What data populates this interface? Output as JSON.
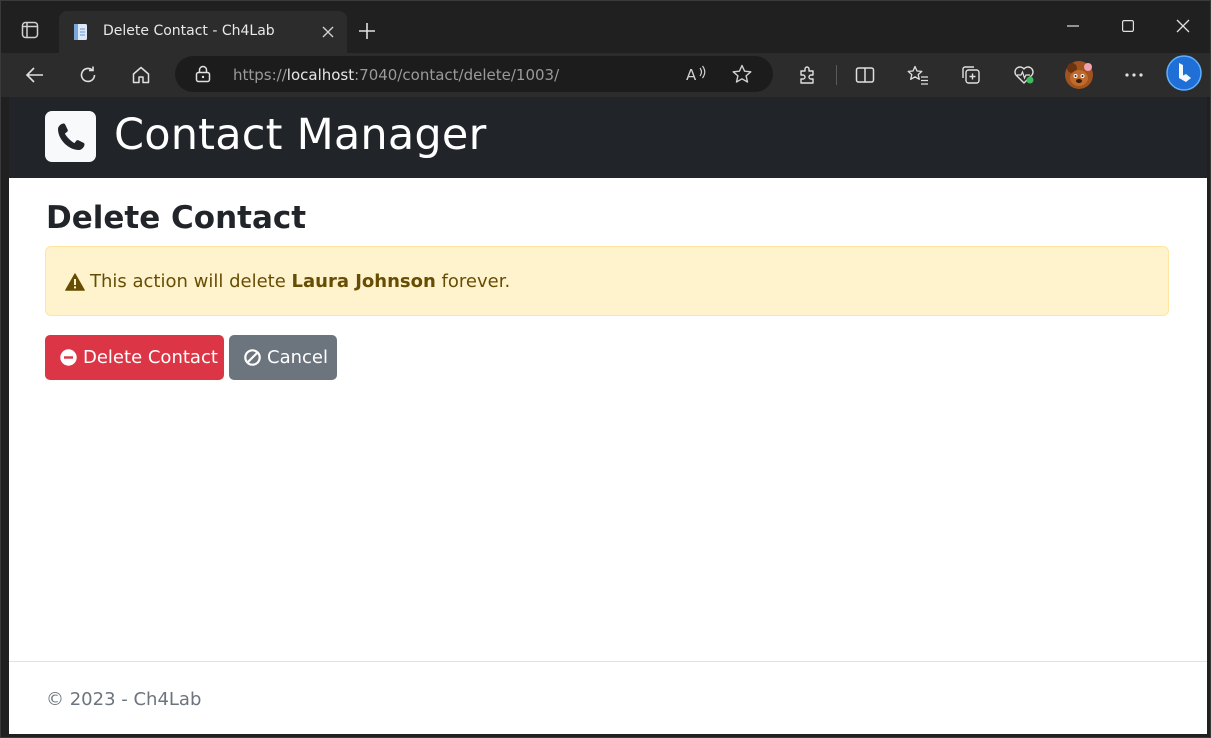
{
  "browser": {
    "tab": {
      "title": "Delete Contact - Ch4Lab"
    },
    "address": {
      "scheme": "https://",
      "host": "localhost",
      "rest": ":7040/contact/delete/1003/"
    }
  },
  "navbar": {
    "brand": "Contact Manager"
  },
  "main": {
    "title": "Delete Contact",
    "alert": {
      "prefix": "This action will delete ",
      "name": "Laura Johnson",
      "suffix": " forever."
    },
    "buttons": {
      "delete_label": "Delete Contact",
      "cancel_label": "Cancel"
    }
  },
  "footer": {
    "text": "© 2023 - Ch4Lab"
  },
  "colors": {
    "navbar_bg": "#212529",
    "danger": "#dc3545",
    "secondary": "#6c757d",
    "alert_bg": "#fff3cd",
    "alert_text": "#664d03"
  },
  "icons": {
    "brand": "phone-icon",
    "alert": "warning-triangle-icon",
    "delete": "minus-circle-icon",
    "cancel": "ban-icon"
  }
}
